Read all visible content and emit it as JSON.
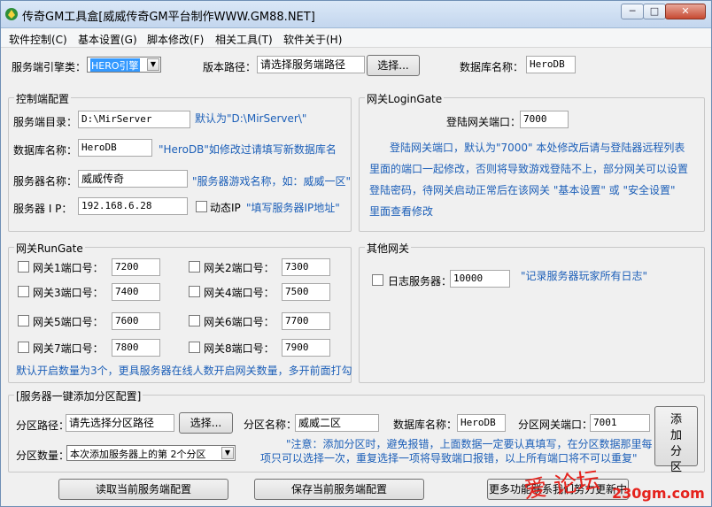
{
  "window": {
    "title": "传奇GM工具盒[威威传奇GM平台制作WWW.GM88.NET]",
    "controls": {
      "minimize": "─",
      "maximize": "□",
      "close": "✕"
    }
  },
  "menu": [
    "软件控制(C)",
    "基本设置(G)",
    "脚本修改(F)",
    "相关工具(T)",
    "软件关于(H)"
  ],
  "top": {
    "engine_label": "服务端引擎类：",
    "engine_value": "HERO引擎",
    "path_label": "版本路径：",
    "path_value": "请选择服务端路径",
    "browse_label": "选择...",
    "db_label": "数据库名称：",
    "db_value": "HeroDB"
  },
  "control": {
    "title": "控制端配置",
    "dir_label": "服务端目录：",
    "dir_value": "D:\\MirServer",
    "dir_hint": "默认为\"D:\\MirServer\\\"",
    "db_label": "数据库名称：",
    "db_value": "HeroDB",
    "db_hint": "\"HeroDB\"如修改过请填写新数据库名",
    "server_label": "服务器名称：",
    "server_value": "威威传奇",
    "server_hint": "\"服务器游戏名称，如：威威一区\"",
    "ip_label": "服务器 I P：",
    "ip_value": "192.168.6.28",
    "dynamic_ip_label": "动态IP",
    "ip_hint": "\"填写服务器IP地址\""
  },
  "login": {
    "title": "网关LoginGate",
    "port_label": "登陆网关端口：",
    "port_value": "7000",
    "desc": [
      "登陆网关端口，默认为\"7000\" 本处修改后请与登陆器远程列表",
      "里面的端口一起修改，否则将导致游戏登陆不上，部分网关可以设置",
      "登陆密码，待网关启动正常后在该网关 \"基本设置\" 或 \"安全设置\"",
      "里面查看修改"
    ]
  },
  "rungate": {
    "title": "网关RunGate",
    "ports": [
      {
        "label": "网关1端口号：",
        "value": "7200"
      },
      {
        "label": "网关2端口号：",
        "value": "7300"
      },
      {
        "label": "网关3端口号：",
        "value": "7400"
      },
      {
        "label": "网关4端口号：",
        "value": "7500"
      },
      {
        "label": "网关5端口号：",
        "value": "7600"
      },
      {
        "label": "网关6端口号：",
        "value": "7700"
      },
      {
        "label": "网关7端口号：",
        "value": "7800"
      },
      {
        "label": "网关8端口号：",
        "value": "7900"
      }
    ],
    "note": "默认开启数量为3个，更具服务器在线人数开启网关数量，多开前面打勾"
  },
  "other": {
    "title": "其他网关",
    "log_label": "日志服务器：",
    "log_value": "10000",
    "log_hint": "\"记录服务器玩家所有日志\""
  },
  "partition": {
    "title": "[服务器一键添加分区配置]",
    "path_label": "分区路径：",
    "path_value": "请先选择分区路径",
    "browse_label": "选择...",
    "name_label": "分区名称：",
    "name_value": "威威二区",
    "db_label": "数据库名称：",
    "db_value": "HeroDB",
    "port_label": "分区网关端口：",
    "port_value": "7001",
    "count_label": "分区数量：",
    "count_value": "本次添加服务器上的第 2个分区",
    "note_line1": "\"注意：添加分区时，避免报错，上面数据一定要认真填写，在分区数据那里每",
    "note_line2": "项只可以选择一次，重复选择一项将导致端口报错，以上所有端口将不可以重复\"",
    "add_button": "添加分区"
  },
  "bottom": {
    "read_button": "读取当前服务端配置",
    "save_button": "保存当前服务端配置",
    "update_button": "更多功能联系我们努力更新中"
  },
  "watermark": {
    "text": "爱 论坛",
    "url": "230gm.com"
  },
  "colors": {
    "hint_blue": "#1c5fb8",
    "watermark_red": "#e5221c",
    "highlight": "#3399ff"
  }
}
